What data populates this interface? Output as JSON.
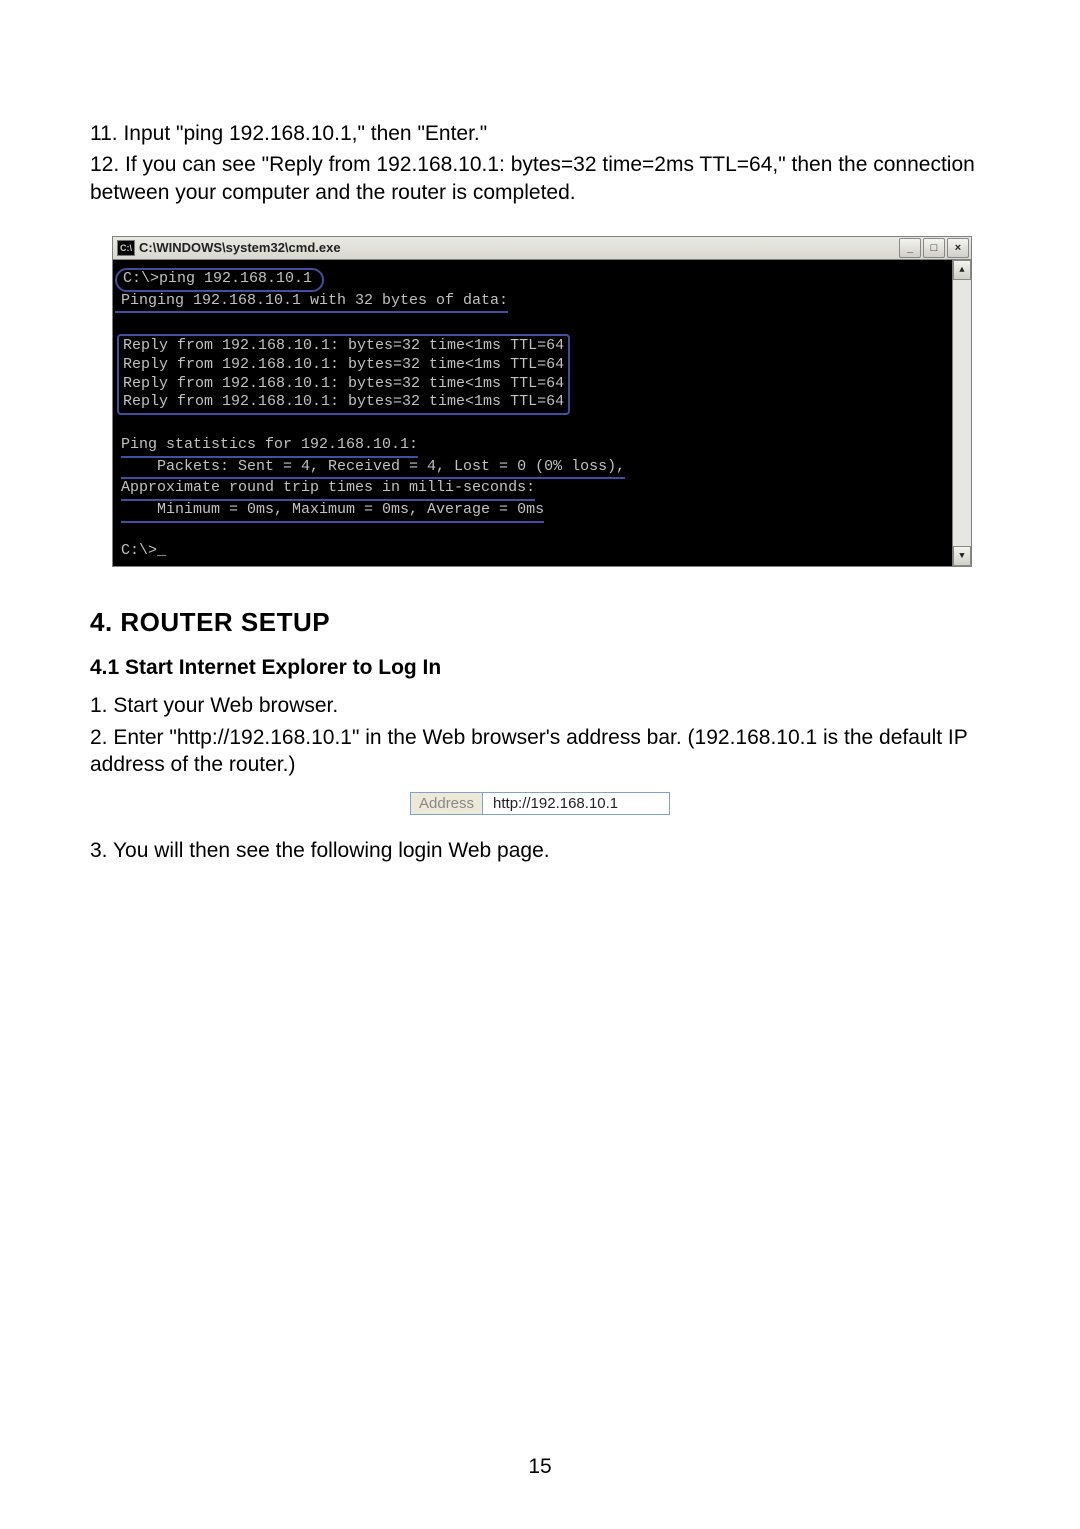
{
  "steps": {
    "s11": "11. Input \"ping 192.168.10.1,\" then \"Enter.\"",
    "s12": "12. If you can see \"Reply from 192.168.10.1: bytes=32 time=2ms TTL=64,\" then the connection between your computer and the router is completed."
  },
  "cmd": {
    "title_icon": "C:\\",
    "title": "C:\\WINDOWS\\system32\\cmd.exe",
    "line_cmd": "C:\\>ping 192.168.10.1",
    "line_pinging": "Pinging 192.168.10.1 with 32 bytes of data:",
    "reply1": "Reply from 192.168.10.1: bytes=32 time<1ms TTL=64",
    "reply2": "Reply from 192.168.10.1: bytes=32 time<1ms TTL=64",
    "reply3": "Reply from 192.168.10.1: bytes=32 time<1ms TTL=64",
    "reply4": "Reply from 192.168.10.1: bytes=32 time<1ms TTL=64",
    "stats1": "Ping statistics for 192.168.10.1:",
    "stats2": "    Packets: Sent = 4, Received = 4, Lost = 0 (0% loss),",
    "stats3": "Approximate round trip times in milli-seconds:",
    "stats4": "    Minimum = 0ms, Maximum = 0ms, Average = 0ms",
    "prompt": "C:\\>_",
    "min": "_",
    "max": "□",
    "close": "×",
    "up": "▲",
    "down": "▼"
  },
  "section": {
    "heading": "4. ROUTER SETUP",
    "sub1": "4.1 Start Internet Explorer to Log In",
    "p1": "1. Start your Web browser.",
    "p2": "2. Enter \"http://192.168.10.1\" in the Web browser's address bar. (192.168.10.1 is the default IP address of the router.)",
    "p3": "3. You will then see the following login Web page."
  },
  "address": {
    "label": "Address",
    "value": "http://192.168.10.1"
  },
  "page_number": "15"
}
